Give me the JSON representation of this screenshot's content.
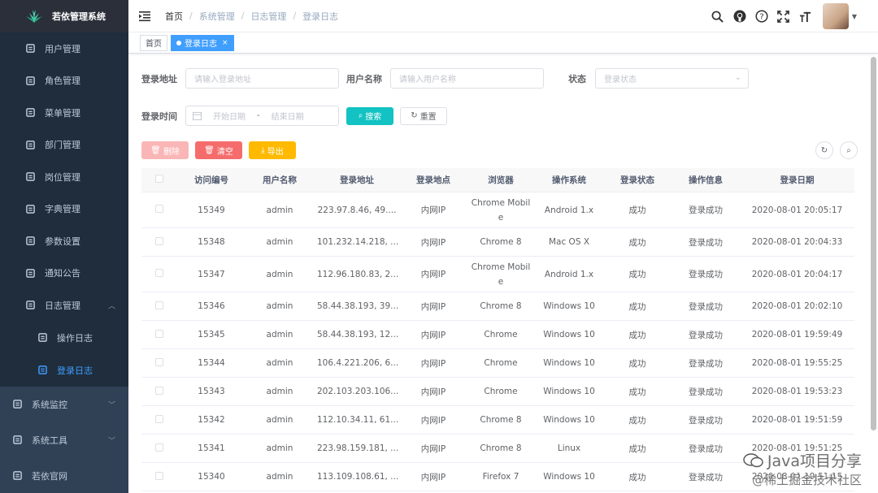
{
  "app": {
    "title": "若依管理系统"
  },
  "sidebar": {
    "items": [
      {
        "label": "用户管理",
        "icon": "user-icon"
      },
      {
        "label": "角色管理",
        "icon": "peoples-icon"
      },
      {
        "label": "菜单管理",
        "icon": "tree-table-icon"
      },
      {
        "label": "部门管理",
        "icon": "tree-icon"
      },
      {
        "label": "岗位管理",
        "icon": "post-icon"
      },
      {
        "label": "字典管理",
        "icon": "dict-icon"
      },
      {
        "label": "参数设置",
        "icon": "edit-icon"
      },
      {
        "label": "通知公告",
        "icon": "message-icon"
      },
      {
        "label": "日志管理",
        "icon": "log-icon"
      }
    ],
    "subitems": [
      {
        "label": "操作日志",
        "icon": "form-icon"
      },
      {
        "label": "登录日志",
        "icon": "logininfor-icon"
      }
    ],
    "groups": [
      {
        "label": "系统监控",
        "icon": "monitor-icon"
      },
      {
        "label": "系统工具",
        "icon": "tool-icon"
      },
      {
        "label": "若依官网",
        "icon": "guide-icon"
      }
    ]
  },
  "breadcrumb": [
    "首页",
    "系统管理",
    "日志管理",
    "登录日志"
  ],
  "tags": {
    "home": "首页",
    "current": "登录日志",
    "close": "×"
  },
  "search": {
    "address_label": "登录地址",
    "address_placeholder": "请输入登录地址",
    "username_label": "用户名称",
    "username_placeholder": "请输入用户名称",
    "status_label": "状态",
    "status_placeholder": "登录状态",
    "time_label": "登录时间",
    "start_placeholder": "开始日期",
    "range_sep": "-",
    "end_placeholder": "结束日期",
    "search_btn": "搜索",
    "reset_btn": "重置"
  },
  "toolbar": {
    "delete": "删除",
    "clean": "清空",
    "export": "导出"
  },
  "table": {
    "headers": [
      "访问编号",
      "用户名称",
      "登录地址",
      "登录地点",
      "浏览器",
      "操作系统",
      "登录状态",
      "操作信息",
      "登录日期"
    ],
    "rows": [
      {
        "id": "15349",
        "user": "admin",
        "ip": "223.97.8.46, 49....",
        "loc": "内网IP",
        "browser": "Chrome Mobile",
        "os": "Android 1.x",
        "status": "成功",
        "msg": "登录成功",
        "date": "2020-08-01 20:05:17",
        "tall": true
      },
      {
        "id": "15348",
        "user": "admin",
        "ip": "101.232.14.218, ...",
        "loc": "内网IP",
        "browser": "Chrome 8",
        "os": "Mac OS X",
        "status": "成功",
        "msg": "登录成功",
        "date": "2020-08-01 20:04:33",
        "tall": false
      },
      {
        "id": "15347",
        "user": "admin",
        "ip": "112.96.180.83, 2...",
        "loc": "内网IP",
        "browser": "Chrome Mobile",
        "os": "Android 1.x",
        "status": "成功",
        "msg": "登录成功",
        "date": "2020-08-01 20:04:17",
        "tall": true
      },
      {
        "id": "15346",
        "user": "admin",
        "ip": "58.44.38.193, 39...",
        "loc": "内网IP",
        "browser": "Chrome 8",
        "os": "Windows 10",
        "status": "成功",
        "msg": "登录成功",
        "date": "2020-08-01 20:02:10",
        "tall": false
      },
      {
        "id": "15345",
        "user": "admin",
        "ip": "58.44.38.193, 12...",
        "loc": "内网IP",
        "browser": "Chrome",
        "os": "Windows 10",
        "status": "成功",
        "msg": "登录成功",
        "date": "2020-08-01 19:59:49",
        "tall": false
      },
      {
        "id": "15344",
        "user": "admin",
        "ip": "106.4.221.206, 6...",
        "loc": "内网IP",
        "browser": "Chrome",
        "os": "Windows 10",
        "status": "成功",
        "msg": "登录成功",
        "date": "2020-08-01 19:55:25",
        "tall": false
      },
      {
        "id": "15343",
        "user": "admin",
        "ip": "202.103.203.106...",
        "loc": "内网IP",
        "browser": "Chrome",
        "os": "Windows 10",
        "status": "成功",
        "msg": "登录成功",
        "date": "2020-08-01 19:53:23",
        "tall": false
      },
      {
        "id": "15342",
        "user": "admin",
        "ip": "112.10.34.11, 61...",
        "loc": "内网IP",
        "browser": "Chrome 8",
        "os": "Windows 10",
        "status": "成功",
        "msg": "登录成功",
        "date": "2020-08-01 19:51:59",
        "tall": false
      },
      {
        "id": "15341",
        "user": "admin",
        "ip": "223.98.159.181, ...",
        "loc": "内网IP",
        "browser": "Chrome 8",
        "os": "Linux",
        "status": "成功",
        "msg": "登录成功",
        "date": "2020-08-01 19:51:25",
        "tall": false
      },
      {
        "id": "15340",
        "user": "admin",
        "ip": "113.109.108.61, ...",
        "loc": "内网IP",
        "browser": "Firefox 7",
        "os": "Windows 10",
        "status": "成功",
        "msg": "登录成功",
        "date": "2020-08-01 19:51:15",
        "tall": false
      }
    ]
  },
  "watermark": {
    "line1": "Java项目分享",
    "line2": "@稀土掘金技术社区"
  },
  "colors": {
    "sidebar_bg": "#304156",
    "accent": "#409eff",
    "search": "#13c2c2",
    "danger": "#f56c6c",
    "warning": "#ffba00"
  }
}
